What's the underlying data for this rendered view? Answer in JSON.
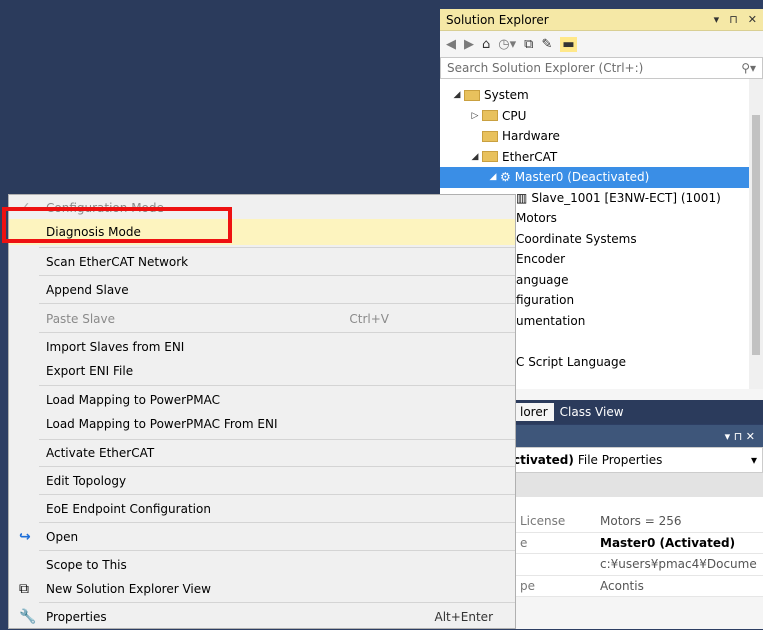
{
  "solution_explorer": {
    "title": "Solution Explorer",
    "controls": [
      "▾",
      "⊓",
      "✕"
    ],
    "search_placeholder": "Search Solution Explorer (Ctrl+:)",
    "search_icon": "search-icon",
    "tree": [
      {
        "label": "System",
        "arrow": "◢"
      },
      {
        "label": "CPU",
        "arrow": "▷"
      },
      {
        "label": "Hardware",
        "arrow": ""
      },
      {
        "label": "EtherCAT",
        "arrow": "◢"
      },
      {
        "label": "Master0 (Deactivated)",
        "arrow": "◢"
      },
      {
        "label": "Slave_1001 [E3NW-ECT] (1001)",
        "arrow": ""
      },
      {
        "label": "Motors",
        "arrow": ""
      },
      {
        "label": "Coordinate Systems",
        "arrow": ""
      },
      {
        "label": "Encoder",
        "arrow": ""
      },
      {
        "label": "anguage",
        "arrow": ""
      },
      {
        "label": "figuration",
        "arrow": ""
      },
      {
        "label": "umentation",
        "arrow": ""
      },
      {
        "label": "",
        "arrow": ""
      },
      {
        "label": "C Script Language",
        "arrow": ""
      }
    ]
  },
  "bottom_tabs": {
    "tab1": "lorer",
    "tab2": "Class View"
  },
  "properties": {
    "title_controls": "▾  ⊓  ✕",
    "header_bold": "ctivated)",
    "header_rest": "File Properties",
    "rows": [
      {
        "key": "License",
        "value": "Motors = 256",
        "bold": false
      },
      {
        "key": "e",
        "value": "Master0 (Activated)",
        "bold": true
      },
      {
        "key": "",
        "value": "c:¥users¥pmac4¥Docume",
        "bold": false
      },
      {
        "key": "pe",
        "value": "Acontis",
        "bold": false
      }
    ]
  },
  "context_menu": {
    "items": [
      {
        "label": "Configuration Mode",
        "disabled": true,
        "check": "✓"
      },
      {
        "label": "Diagnosis Mode",
        "highlighted": true
      },
      {
        "label": "Scan EtherCAT Network"
      },
      {
        "label": "Append Slave"
      },
      {
        "label": "Paste Slave",
        "disabled": true,
        "shortcut": "Ctrl+V"
      },
      {
        "label": "Import Slaves from ENI"
      },
      {
        "label": "Export ENI File"
      },
      {
        "label": "Load Mapping to PowerPMAC"
      },
      {
        "label": "Load Mapping to PowerPMAC From ENI"
      },
      {
        "label": "Activate EtherCAT"
      },
      {
        "label": "Edit Topology"
      },
      {
        "label": "EoE Endpoint Configuration"
      },
      {
        "label": "Open",
        "icon": "open-arrow-icon"
      },
      {
        "label": "Scope to This"
      },
      {
        "label": "New Solution Explorer View",
        "icon": "new-view-icon"
      },
      {
        "label": "Properties",
        "icon": "wrench-icon",
        "shortcut": "Alt+Enter"
      }
    ]
  },
  "colors": {
    "selection": "#3a8ee6",
    "highlight_outline": "#e11",
    "title_bar": "#f5e8a6"
  }
}
